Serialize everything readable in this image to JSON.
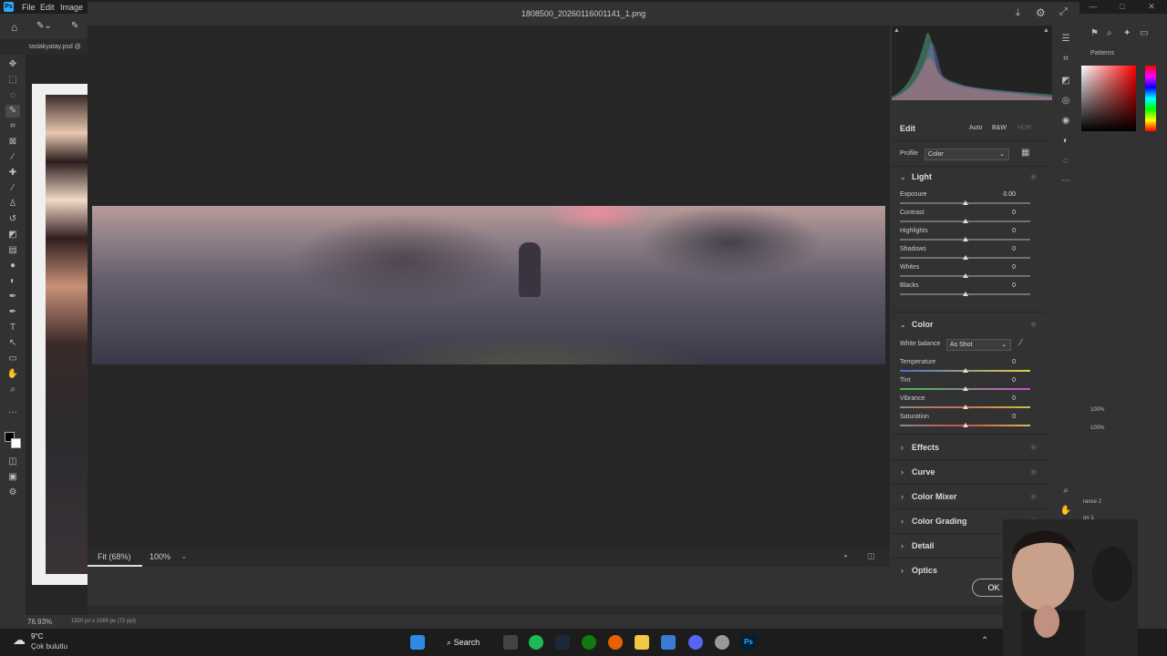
{
  "ps": {
    "menu": [
      "File",
      "Edit",
      "Image"
    ],
    "doc_tab": "taslakyatay.psd @",
    "zoom": "76.93%",
    "doc_info": "1920 px x 1080 px (72 ppi)",
    "panel_tabs": [
      "Patterns"
    ],
    "layers": [
      "rance 2",
      "on 1"
    ],
    "opacity_values": [
      "100%",
      "100%"
    ]
  },
  "acr": {
    "filename": "1808500_20260116001141_1.png",
    "fit_label": "Fit (68%)",
    "zoom_label": "100%",
    "ok_label": "OK",
    "edit": {
      "title": "Edit",
      "auto": "Auto",
      "bw": "B&W",
      "hdr": "HDR",
      "profile_label": "Profile",
      "profile_value": "Color"
    },
    "light": {
      "title": "Light",
      "sliders": [
        {
          "label": "Exposure",
          "value": "0.00"
        },
        {
          "label": "Contrast",
          "value": "0"
        },
        {
          "label": "Highlights",
          "value": "0"
        },
        {
          "label": "Shadows",
          "value": "0"
        },
        {
          "label": "Whites",
          "value": "0"
        },
        {
          "label": "Blacks",
          "value": "0"
        }
      ]
    },
    "color": {
      "title": "Color",
      "wb_label": "White balance",
      "wb_value": "As Shot",
      "sliders": [
        {
          "label": "Temperature",
          "value": "0"
        },
        {
          "label": "Tint",
          "value": "0"
        },
        {
          "label": "Vibrance",
          "value": "0"
        },
        {
          "label": "Saturation",
          "value": "0"
        }
      ]
    },
    "collapsed_sections": [
      "Effects",
      "Curve",
      "Color Mixer",
      "Color Grading",
      "Detail",
      "Optics"
    ]
  },
  "taskbar": {
    "weather_temp": "9°C",
    "weather_desc": "Çok bulutlu",
    "search_label": "Search"
  },
  "colors": {
    "ps_blue": "#31a8ff",
    "dialog_bg": "#323232",
    "preview_bg": "#262626"
  }
}
